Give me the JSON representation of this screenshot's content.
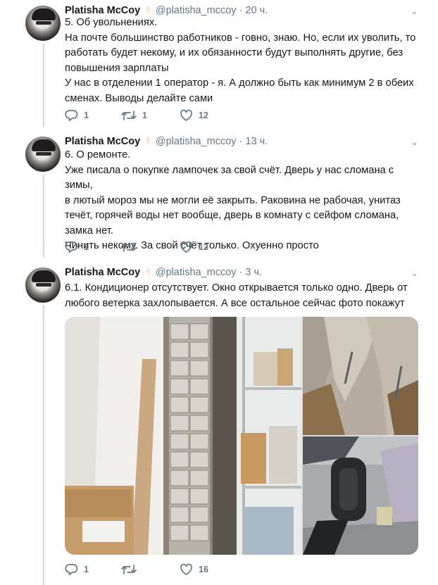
{
  "tweets": [
    {
      "name": "Platisha McCoy",
      "handle": "@platisha_mccoy",
      "time": "20 ч.",
      "lines": [
        "5. Об увольнениях.",
        "На почте большинство работников - говно, знаю. Но, если их уволить, то",
        "работать будет некому, и их обязанности будут выполнять другие, без",
        "повышения зарплаты",
        "У нас в отделении 1 оператор - я. А должно быть как минимум 2 в обеих",
        "сменах. Выводы делайте сами"
      ],
      "replies": "1",
      "retweets": "1",
      "likes": "12"
    },
    {
      "name": "Platisha McCoy",
      "handle": "@platisha_mccoy",
      "time": "13 ч.",
      "lines": [
        "6. О ремонте.",
        "Уже писала о покупке лампочек за свой счёт. Дверь у нас сломана с зимы,",
        "в лютый мороз мы не могли её закрыть. Раковина не рабочая, унитаз",
        "течёт, горячей воды нет вообще, дверь в комнату с сейфом сломана,",
        "замка нет.",
        "Чинить некому. За свой счёт только. Охуенно просто"
      ],
      "replies": "1",
      "retweets": "",
      "likes": "12"
    },
    {
      "name": "Platisha McCoy",
      "handle": "@platisha_mccoy",
      "time": "3 ч.",
      "lines": [
        "6.1. Кондиционер отсутствует. Окно открывается только одно. Дверь от",
        "любого ветерка захлопывается. А все остальное сейчас фото покажут"
      ],
      "replies": "1",
      "retweets": "",
      "likes": "16"
    }
  ],
  "icons": {
    "peace": "victory-hand-icon",
    "menu": "chevron-down-icon",
    "reply": "reply-icon",
    "retweet": "retweet-icon",
    "like": "heart-icon"
  },
  "colors": {
    "text": "#14171a",
    "muted": "#657786",
    "divider": "#ccd6dd"
  }
}
